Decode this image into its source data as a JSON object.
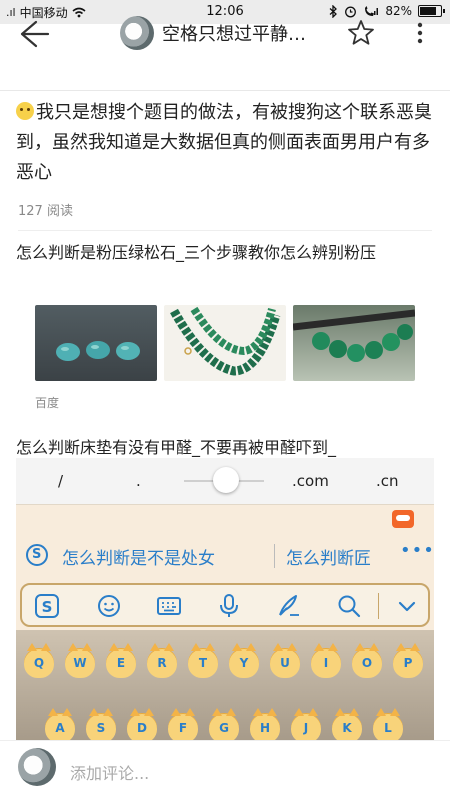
{
  "status": {
    "carrier": "中国移动",
    "signal": ".ıl",
    "time": "12:06",
    "battery_percent": "82%",
    "battery_level": 0.82
  },
  "header": {
    "title": "空格只想过平静…"
  },
  "post": {
    "text": "我只是想搜个题目的做法，有被搜狗这个联系恶臭到，虽然我知道是大数据但真的侧面表面男用户有多恶心",
    "reads": "127 阅读"
  },
  "related": [
    {
      "title": "怎么判断是粉压绿松石_三个步骤教你怎么辨别粉压",
      "source": "百度"
    },
    {
      "title": "怎么判断床垫有没有甲醛_不要再被甲醛吓到_"
    }
  ],
  "keyboard": {
    "shortcuts": [
      "/",
      ".",
      ".com",
      ".cn"
    ],
    "suggestions": [
      "怎么判断是不是处女",
      "怎么判断匠"
    ],
    "more": "•••",
    "row1": [
      "Q",
      "W",
      "E",
      "R",
      "T",
      "Y",
      "U",
      "I",
      "O",
      "P"
    ],
    "row2": [
      "A",
      "S",
      "D",
      "F",
      "G",
      "H",
      "J",
      "K",
      "L"
    ]
  },
  "comment": {
    "placeholder": "添加评论..."
  }
}
